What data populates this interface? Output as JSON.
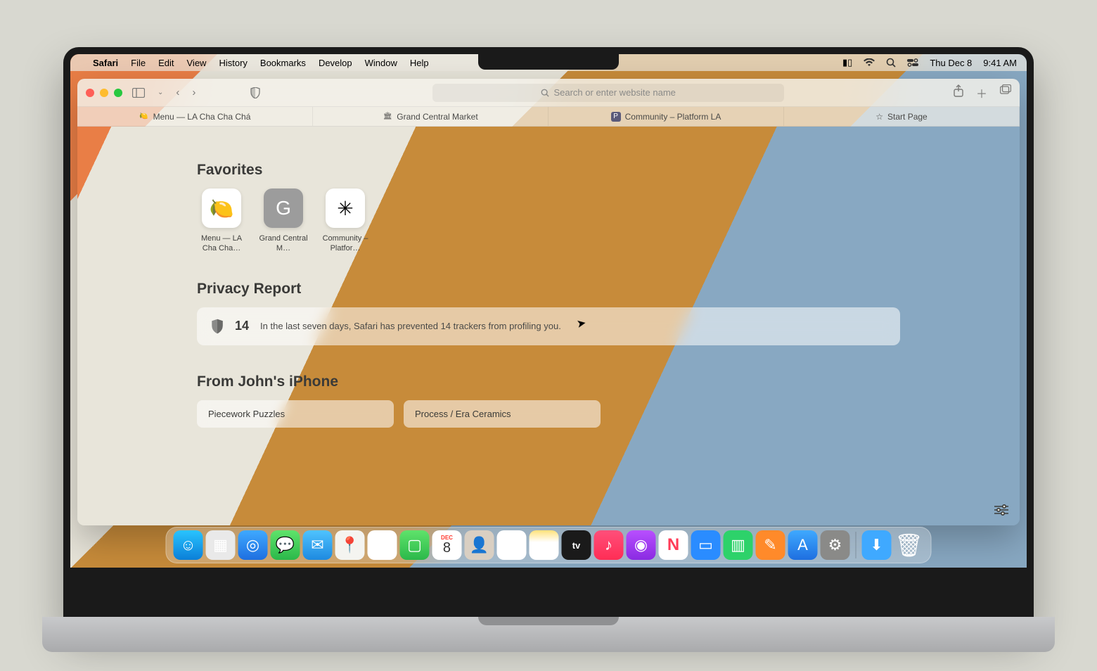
{
  "menubar": {
    "app": "Safari",
    "items": [
      "File",
      "Edit",
      "View",
      "History",
      "Bookmarks",
      "Develop",
      "Window",
      "Help"
    ],
    "date": "Thu Dec 8",
    "time": "9:41 AM"
  },
  "toolbar": {
    "search_placeholder": "Search or enter website name"
  },
  "tabs": [
    {
      "label": "Menu — LA Cha Cha Chá",
      "icon": "🍋"
    },
    {
      "label": "Grand Central Market",
      "icon": "🏛"
    },
    {
      "label": "Community – Platform LA",
      "icon": "P"
    },
    {
      "label": "Start Page",
      "icon": "☆"
    }
  ],
  "startpage": {
    "favorites_heading": "Favorites",
    "favorites": [
      {
        "label": "Menu — LA Cha Cha…",
        "glyph": "🍋",
        "bg": "#ffffff"
      },
      {
        "label": "Grand Central M…",
        "glyph": "G",
        "bg": "#9c9c9c"
      },
      {
        "label": "Community – Platfor…",
        "glyph": "✳",
        "bg": "#ffffff"
      }
    ],
    "privacy_heading": "Privacy Report",
    "privacy_count": "14",
    "privacy_text": "In the last seven days, Safari has prevented 14 trackers from profiling you.",
    "handoff_heading": "From John's iPhone",
    "handoff": [
      {
        "label": "Piecework Puzzles"
      },
      {
        "label": "Process / Era Ceramics"
      }
    ]
  },
  "dock": [
    {
      "name": "finder",
      "bg": "linear-gradient(#29c4ff,#0b7fd8)",
      "glyph": "☺"
    },
    {
      "name": "launchpad",
      "bg": "#e9e9e9",
      "glyph": "▦"
    },
    {
      "name": "safari",
      "bg": "linear-gradient(#3fa9ff,#1e6fe0)",
      "glyph": "◎"
    },
    {
      "name": "messages",
      "bg": "linear-gradient(#5fe36b,#2bb84a)",
      "glyph": "💬"
    },
    {
      "name": "mail",
      "bg": "linear-gradient(#4fc3ff,#1e8ae0)",
      "glyph": "✉"
    },
    {
      "name": "maps",
      "bg": "#f4f4f0",
      "glyph": "📍"
    },
    {
      "name": "photos",
      "bg": "#ffffff",
      "glyph": "❀"
    },
    {
      "name": "facetime",
      "bg": "linear-gradient(#5fe36b,#2bb84a)",
      "glyph": "▢"
    },
    {
      "name": "calendar",
      "bg": "#ffffff",
      "glyph": "8",
      "sub": "DEC"
    },
    {
      "name": "contacts",
      "bg": "#d9cfc2",
      "glyph": "👤"
    },
    {
      "name": "reminders",
      "bg": "#ffffff",
      "glyph": "☰"
    },
    {
      "name": "notes",
      "bg": "linear-gradient(#ffe27a,#ffffff 40%)",
      "glyph": ""
    },
    {
      "name": "tv",
      "bg": "#1a1a1a",
      "glyph": "tv"
    },
    {
      "name": "music",
      "bg": "linear-gradient(#ff4f7a,#ff2d55)",
      "glyph": "♪"
    },
    {
      "name": "podcasts",
      "bg": "linear-gradient(#b84fff,#8a2be2)",
      "glyph": "◉"
    },
    {
      "name": "news",
      "bg": "#ffffff",
      "glyph": "N"
    },
    {
      "name": "keynote",
      "bg": "#2a8cff",
      "glyph": "▭"
    },
    {
      "name": "numbers",
      "bg": "#2dd26a",
      "glyph": "▥"
    },
    {
      "name": "pages",
      "bg": "#ff8a2a",
      "glyph": "✎"
    },
    {
      "name": "appstore",
      "bg": "linear-gradient(#3fa9ff,#1e6fe0)",
      "glyph": "A"
    },
    {
      "name": "settings",
      "bg": "#8a8a88",
      "glyph": "⚙"
    }
  ],
  "dock_right": [
    {
      "name": "downloads",
      "bg": "#3fa9ff",
      "glyph": "⬇"
    },
    {
      "name": "trash",
      "bg": "#e9e9e9",
      "glyph": "🗑"
    }
  ]
}
